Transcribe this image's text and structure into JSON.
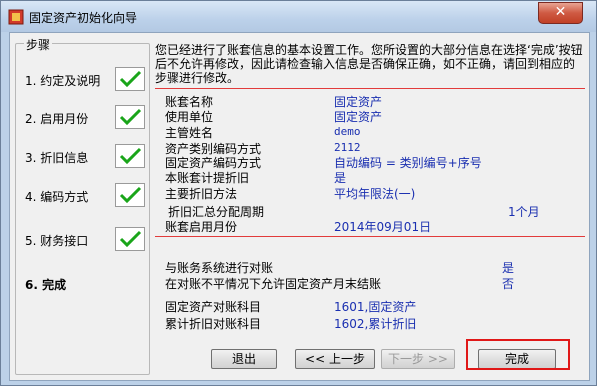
{
  "window": {
    "title": "固定资产初始化向导",
    "close_glyph": "✕"
  },
  "steps": {
    "legend": "步骤",
    "items": [
      {
        "label": "1. 约定及说明",
        "done": true
      },
      {
        "label": "2. 启用月份",
        "done": true
      },
      {
        "label": "3. 折旧信息",
        "done": true
      },
      {
        "label": "4. 编码方式",
        "done": true
      },
      {
        "label": "5. 财务接口",
        "done": true
      },
      {
        "label": "6. 完成",
        "done": false
      }
    ]
  },
  "intro_text": "您已经进行了账套信息的基本设置工作。您所设置的大部分信息在选择‘完成’按钮后不允许再修改，因此请检查输入信息是否确保正确，如不正确，请回到相应的步骤进行修改。",
  "summary": {
    "rows": [
      {
        "label": "账套名称",
        "value": "固定资产"
      },
      {
        "label": "使用单位",
        "value": "固定资产"
      },
      {
        "label": "主管姓名",
        "value": "demo"
      },
      {
        "label": "资产类别编码方式",
        "value": "2112"
      },
      {
        "label": "固定资产编码方式",
        "value": "自动编码 = 类别编号+序号"
      },
      {
        "label": "本账套计提折旧",
        "value": "是"
      },
      {
        "label": "主要折旧方法",
        "value": "平均年限法(一)"
      },
      {
        "label": "折旧汇总分配周期",
        "value": "1个月"
      },
      {
        "label": "账套启用月份",
        "value": "2014年09月01日"
      }
    ],
    "reconcile": [
      {
        "label": "与账务系统进行对账",
        "value": "是"
      },
      {
        "label": "在对账不平情况下允许固定资产月末结账",
        "value": "否"
      }
    ],
    "accounts": [
      {
        "label": "固定资产对账科目",
        "value": "1601,固定资产"
      },
      {
        "label": "累计折旧对账科目",
        "value": "1602,累计折旧"
      }
    ]
  },
  "buttons": {
    "exit": "退出",
    "prev": "<< 上一步",
    "next": "下一步 >>",
    "finish": "完成"
  },
  "colors": {
    "value_text": "#1a2fb0",
    "separator": "#e23b3b",
    "highlight": "#e01818",
    "check": "#1aa51a"
  }
}
